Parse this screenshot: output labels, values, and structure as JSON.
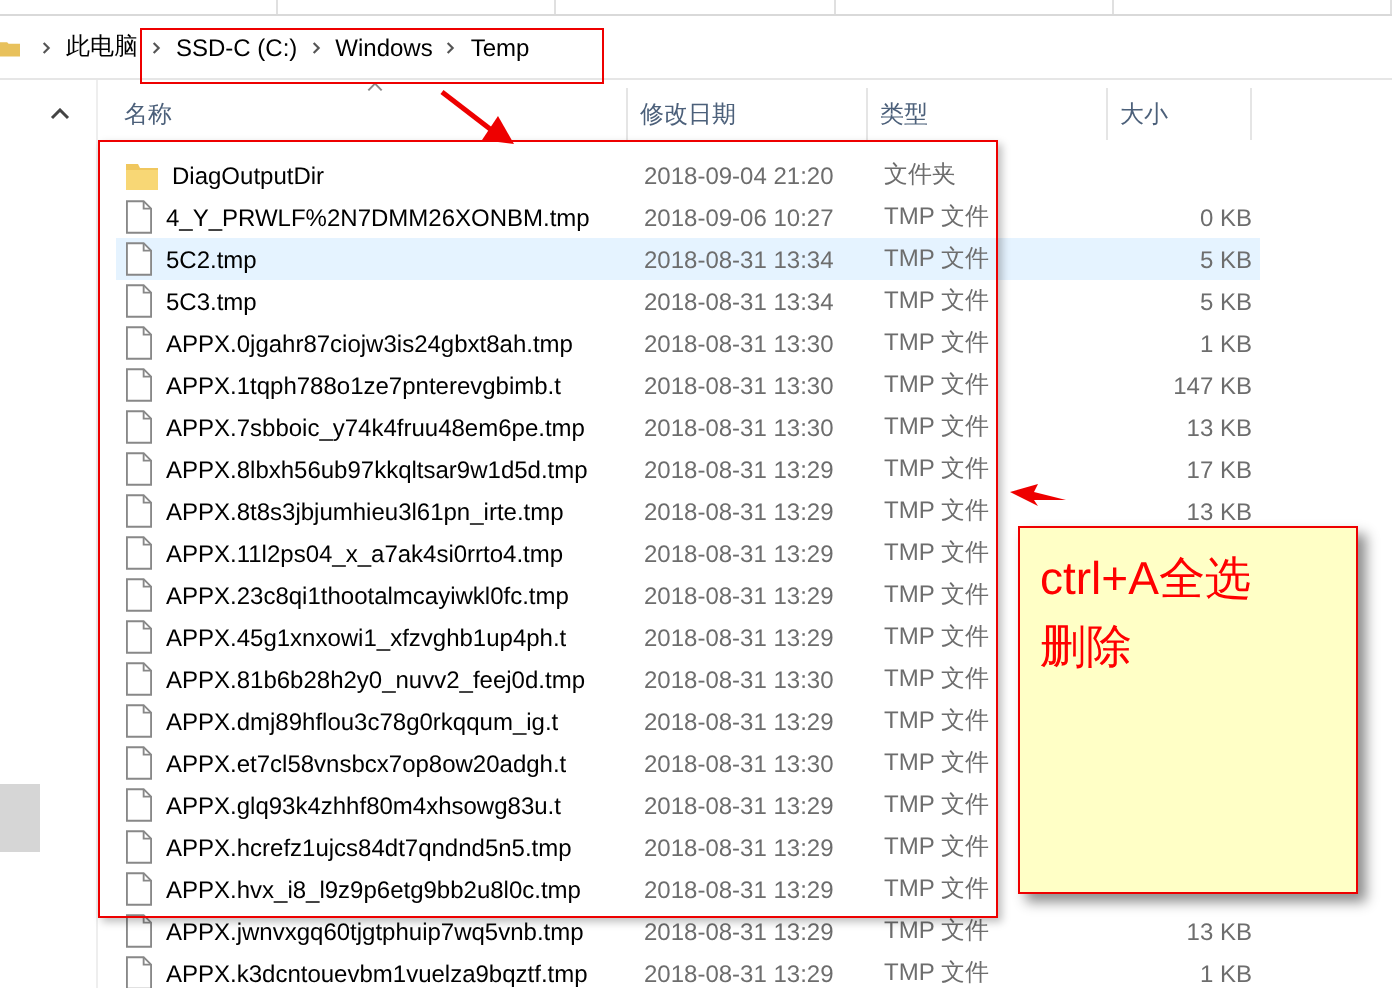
{
  "address_bar": {
    "crumbs": [
      "此电脑",
      "SSD-C (C:)",
      "Windows",
      "Temp"
    ]
  },
  "columns": [
    "名称",
    "修改日期",
    "类型",
    "大小"
  ],
  "rows": [
    {
      "kind": "folder",
      "name": "DiagOutputDir",
      "date": "2018-09-04 21:20",
      "type": "文件夹",
      "selected": false
    },
    {
      "kind": "file",
      "name": "4_Y_PRWLF%2N7DMM26XONBM.tmp",
      "date": "2018-09-06 10:27",
      "type": "TMP 文件",
      "size": "0 KB",
      "selected": false
    },
    {
      "kind": "file",
      "name": "5C2.tmp",
      "date": "2018-08-31 13:34",
      "type": "TMP 文件",
      "size": "5 KB",
      "selected": true
    },
    {
      "kind": "file",
      "name": "5C3.tmp",
      "date": "2018-08-31 13:34",
      "type": "TMP 文件",
      "size": "5 KB",
      "selected": false
    },
    {
      "kind": "file",
      "name": "APPX.0jgahr87ciojw3is24gbxt8ah.tmp",
      "date": "2018-08-31 13:30",
      "type": "TMP 文件",
      "size": "1 KB",
      "selected": false
    },
    {
      "kind": "file",
      "name": "APPX.1tqph788o1ze7pnterevgbimb.t",
      "date": "2018-08-31 13:30",
      "type": "TMP 文件",
      "size": "147 KB",
      "selected": false
    },
    {
      "kind": "file",
      "name": "APPX.7sbboic_y74k4fruu48em6pe.tmp",
      "date": "2018-08-31 13:30",
      "type": "TMP 文件",
      "size": "13 KB",
      "selected": false
    },
    {
      "kind": "file",
      "name": "APPX.8lbxh56ub97kkqltsar9w1d5d.tmp",
      "date": "2018-08-31 13:29",
      "type": "TMP 文件",
      "size": "17 KB",
      "selected": false
    },
    {
      "kind": "file",
      "name": "APPX.8t8s3jbjumhieu3l61pn_irte.tmp",
      "date": "2018-08-31 13:29",
      "type": "TMP 文件",
      "size": "13 KB",
      "selected": false
    },
    {
      "kind": "file",
      "name": "APPX.11l2ps04_x_a7ak4si0rrto4.tmp",
      "date": "2018-08-31 13:29",
      "type": "TMP 文件",
      "selected": false
    },
    {
      "kind": "file",
      "name": "APPX.23c8qi1thootalmcayiwkl0fc.tmp",
      "date": "2018-08-31 13:29",
      "type": "TMP 文件",
      "selected": false
    },
    {
      "kind": "file",
      "name": "APPX.45g1xnxowi1_xfzvghb1up4ph.t",
      "date": "2018-08-31 13:29",
      "type": "TMP 文件",
      "selected": false
    },
    {
      "kind": "file",
      "name": "APPX.81b6b28h2y0_nuvv2_feej0d.tmp",
      "date": "2018-08-31 13:30",
      "type": "TMP 文件",
      "selected": false
    },
    {
      "kind": "file",
      "name": "APPX.dmj89hflou3c78g0rkqqum_ig.t",
      "date": "2018-08-31 13:29",
      "type": "TMP 文件",
      "selected": false
    },
    {
      "kind": "file",
      "name": "APPX.et7cl58vnsbcx7op8ow20adgh.t",
      "date": "2018-08-31 13:30",
      "type": "TMP 文件",
      "selected": false
    },
    {
      "kind": "file",
      "name": "APPX.glq93k4zhhf80m4xhsowg83u.t",
      "date": "2018-08-31 13:29",
      "type": "TMP 文件",
      "selected": false
    },
    {
      "kind": "file",
      "name": "APPX.hcrefz1ujcs84dt7qndnd5n5.tmp",
      "date": "2018-08-31 13:29",
      "type": "TMP 文件",
      "selected": false
    },
    {
      "kind": "file",
      "name": "APPX.hvx_i8_l9z9p6etg9bb2u8l0c.tmp",
      "date": "2018-08-31 13:29",
      "type": "TMP 文件",
      "selected": false
    },
    {
      "kind": "file",
      "name": "APPX.jwnvxgq60tjgtphuip7wq5vnb.tmp",
      "date": "2018-08-31 13:29",
      "type": "TMP 文件",
      "size": "13 KB",
      "selected": false
    },
    {
      "kind": "file",
      "name": "APPX.k3dcntouevbm1vuelza9bqztf.tmp",
      "date": "2018-08-31 13:29",
      "type": "TMP 文件",
      "size": "1 KB",
      "selected": false
    }
  ],
  "note": {
    "lines": [
      "ctrl+A全选",
      "删除"
    ]
  }
}
